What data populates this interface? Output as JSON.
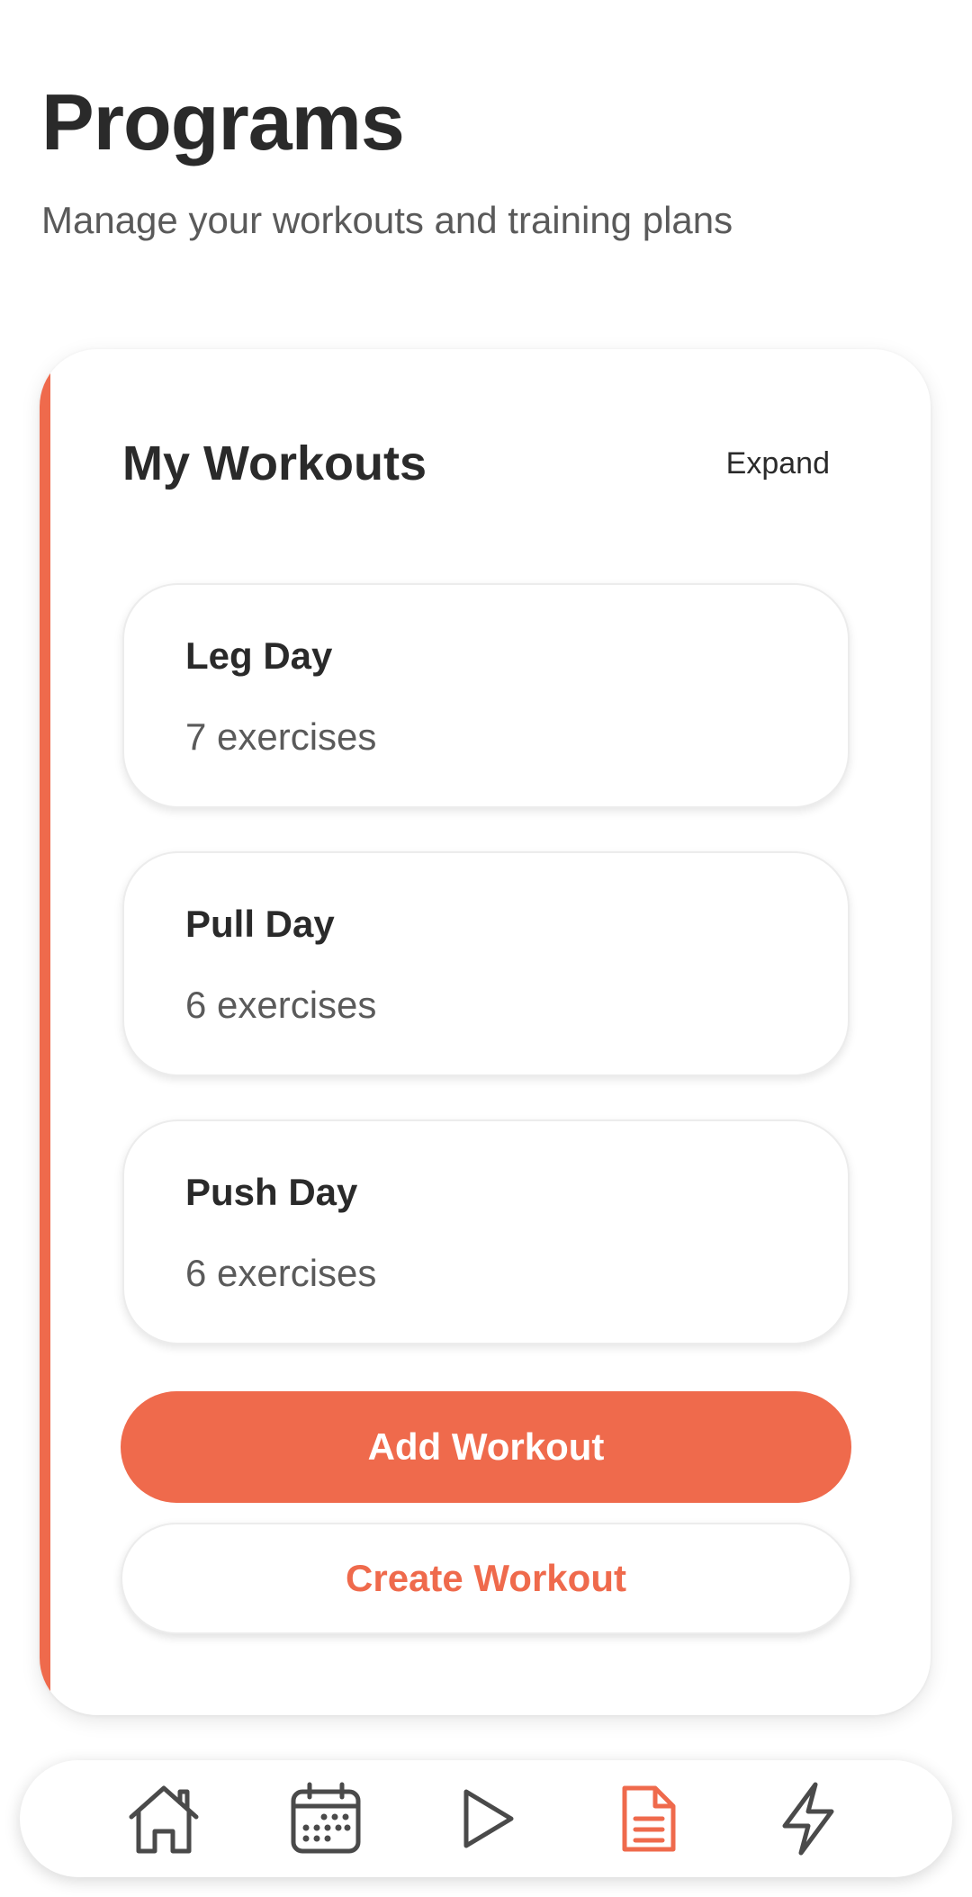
{
  "header": {
    "title": "Programs",
    "subtitle": "Manage your workouts and training plans"
  },
  "workouts_card": {
    "title": "My Workouts",
    "expand_label": "Expand",
    "items": [
      {
        "name": "Leg Day",
        "count": "7 exercises"
      },
      {
        "name": "Pull Day",
        "count": "6 exercises"
      },
      {
        "name": "Push Day",
        "count": "6 exercises"
      }
    ],
    "add_button_label": "Add Workout",
    "create_button_label": "Create Workout"
  },
  "bottom_nav": {
    "items": [
      {
        "icon": "home-icon",
        "active": false
      },
      {
        "icon": "calendar-icon",
        "active": false
      },
      {
        "icon": "play-icon",
        "active": false
      },
      {
        "icon": "document-icon",
        "active": true
      },
      {
        "icon": "lightning-icon",
        "active": false
      }
    ]
  },
  "colors": {
    "accent": "#ef6a4c",
    "text_primary": "#2a2a2a",
    "text_secondary": "#5a5a5a",
    "icon_inactive": "#4a4a4a"
  }
}
